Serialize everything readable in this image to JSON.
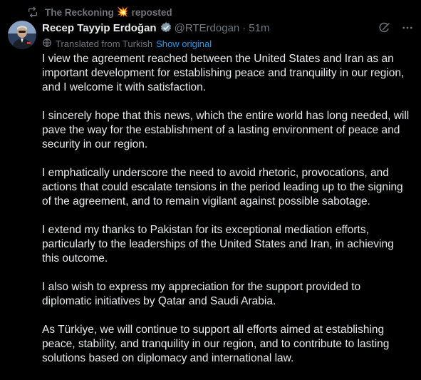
{
  "repost": {
    "user": "The Reckoning",
    "emoji": "💥",
    "label": "reposted",
    "icon": "repost-icon"
  },
  "post": {
    "author_name": "Recep Tayyip Erdoğan",
    "verified_icon": "verified-badge-icon",
    "handle": "@RTErdogan",
    "separator": "·",
    "time": "51m",
    "grok_icon": "grok-icon",
    "more_icon": "more-icon",
    "translation": {
      "icon": "globe-icon",
      "label": "Translated from Turkish",
      "link": "Show original"
    },
    "paragraphs": [
      "I view the agreement reached between the United States and Iran as an important development for establishing peace and tranquility in our region, and I welcome it with satisfaction.",
      "I sincerely hope that this news, which the entire world has long needed, will pave the way for the establishment of a lasting environment of peace and security in our region.",
      "I emphatically underscore the need to avoid rhetoric, provocations, and actions that could escalate tensions in the period leading up to the signing of the agreement, and to remain vigilant against possible sabotage.",
      "I extend my thanks to Pakistan for its exceptional mediation efforts, particularly to the leaderships of the United States and Iran, in achieving this outcome.",
      "I also wish to express my appreciation for the support provided to diplomatic initiatives by Qatar and Saudi Arabia.",
      "As Türkiye, we will continue to support all efforts aimed at establishing peace, stability, and tranquility in our region, and to contribute to lasting solutions based on diplomacy and international law."
    ]
  },
  "colors": {
    "background": "#000000",
    "text": "#e7e9ea",
    "muted": "#71767b",
    "link": "#1d9bf0"
  }
}
